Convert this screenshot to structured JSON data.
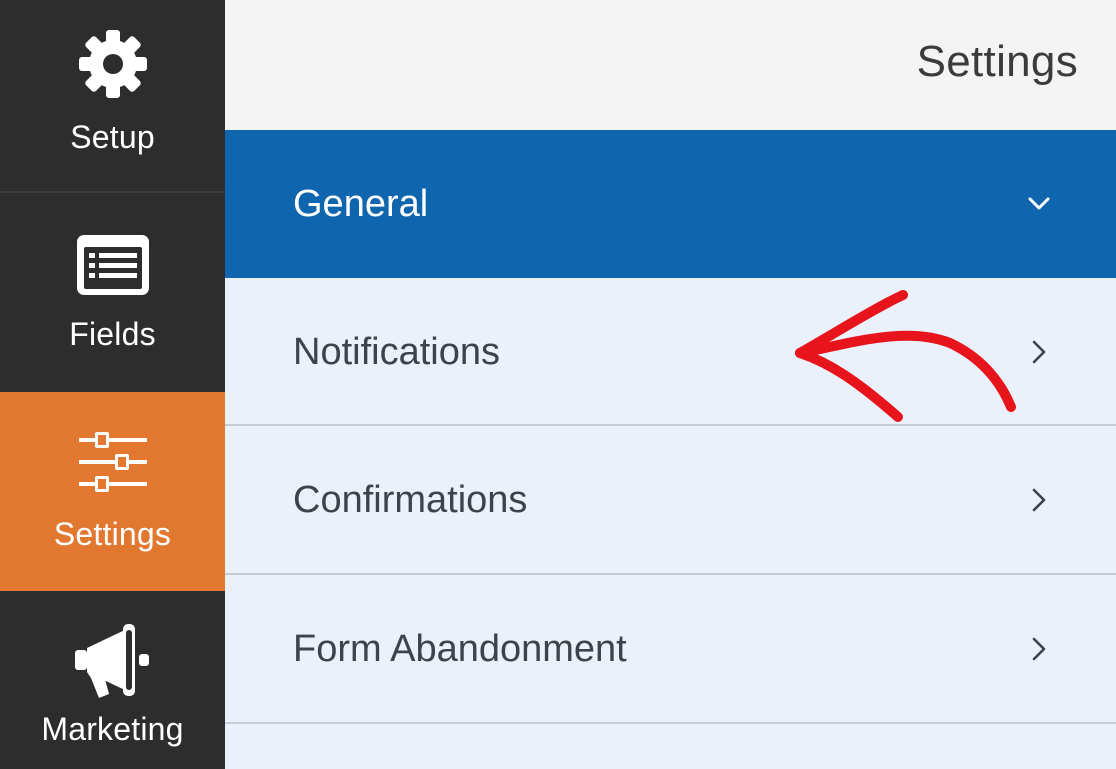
{
  "header": {
    "title": "Settings"
  },
  "sidebar": {
    "items": [
      {
        "label": "Setup",
        "icon": "gear-icon"
      },
      {
        "label": "Fields",
        "icon": "list-icon"
      },
      {
        "label": "Settings",
        "icon": "sliders-icon",
        "active": true
      },
      {
        "label": "Marketing",
        "icon": "megaphone-icon"
      }
    ]
  },
  "panels": [
    {
      "label": "General",
      "expanded": true,
      "icon": "chevron-down-icon"
    },
    {
      "label": "Notifications",
      "icon": "chevron-right-icon"
    },
    {
      "label": "Confirmations",
      "icon": "chevron-right-icon"
    },
    {
      "label": "Form Abandonment",
      "icon": "chevron-right-icon"
    }
  ],
  "annotation": {
    "icon": "hand-drawn-arrow-icon",
    "color": "#e8141c"
  },
  "colors": {
    "sidebar_bg": "#2d2d2d",
    "active_orange": "#e27730",
    "general_blue": "#1066ae",
    "panel_bg": "#eaf1fb",
    "header_bg": "#f4f4f4"
  }
}
